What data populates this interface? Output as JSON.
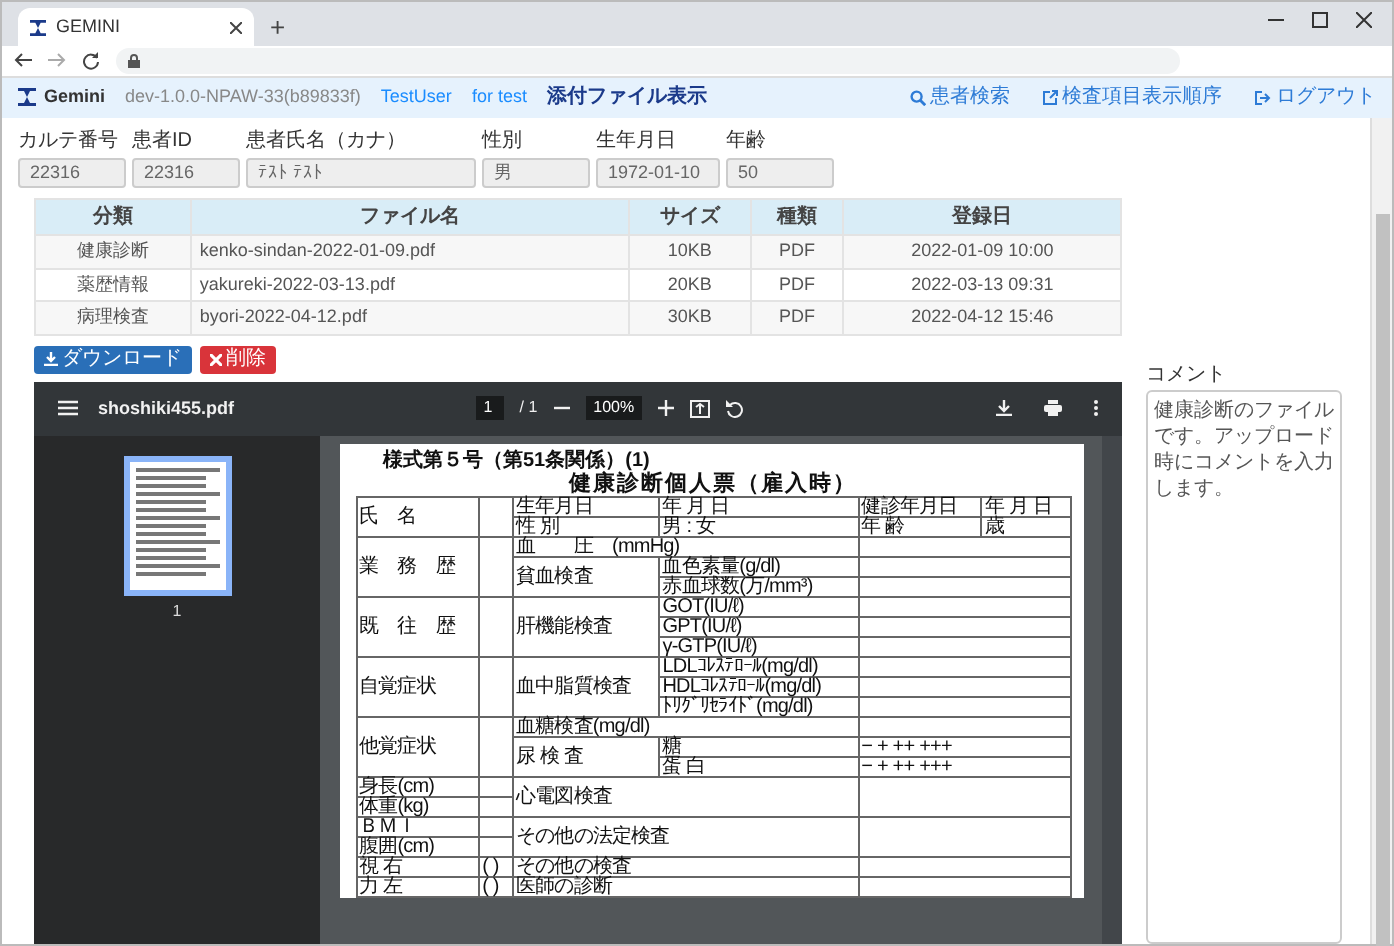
{
  "browser": {
    "tab_title": "GEMINI",
    "new_tab": "+"
  },
  "navbar": {
    "brand": "Gemini",
    "version": "dev-1.0.0-NPAW-33(b89833f)",
    "links": [
      {
        "label": "TestUser",
        "selected": false
      },
      {
        "label": "for test",
        "selected": false
      },
      {
        "label": "添付ファイル表示",
        "selected": true
      }
    ],
    "right_links": [
      {
        "label": "患者検索",
        "kind": "search"
      },
      {
        "label": "検査項目表示順序",
        "kind": "external"
      },
      {
        "label": "ログアウト",
        "kind": "logout"
      }
    ]
  },
  "patient_fields": [
    {
      "label": "カルテ番号",
      "value": "22316"
    },
    {
      "label": "患者ID",
      "value": "22316"
    },
    {
      "label": "患者氏名（カナ）",
      "value": "ﾃｽﾄ ﾃｽﾄ"
    },
    {
      "label": "性別",
      "value": "男"
    },
    {
      "label": "生年月日",
      "value": "1972-01-10"
    },
    {
      "label": "年齢",
      "value": "50"
    }
  ],
  "files_table": {
    "columns": [
      "分類",
      "ファイル名",
      "サイズ",
      "種類",
      "登録日"
    ],
    "rows": [
      [
        "健康診断",
        "kenko-sindan-2022-01-09.pdf",
        "10KB",
        "PDF",
        "2022-01-09 10:00"
      ],
      [
        "薬歴情報",
        "yakureki-2022-03-13.pdf",
        "20KB",
        "PDF",
        "2022-03-13 09:31"
      ],
      [
        "病理検査",
        "byori-2022-04-12.pdf",
        "30KB",
        "PDF",
        "2022-04-12 15:46"
      ]
    ]
  },
  "buttons": [
    {
      "label": "ダウンロード",
      "kind": "download"
    },
    {
      "label": "削除",
      "kind": "delete"
    }
  ],
  "pdf_viewer": {
    "file_name": "shoshiki455.pdf",
    "page": "1",
    "page_total": "/ 1",
    "zoom": "100%",
    "thumbnail_label": "1",
    "document": {
      "form_number": "様式第５号（第51条関係）(1)",
      "title": "健康診断個人票（雇入時）",
      "rows": [
        [
          {
            "text": "氏　名",
            "rowspan": 2
          },
          {
            "rowspan": 2
          },
          {
            "text": "生年月日"
          },
          {
            "text": "年 月 日"
          },
          {
            "text": "健診年月日"
          },
          {
            "text": "年 月 日"
          }
        ],
        [
          {
            "text": "性 別"
          },
          {
            "text": "男 : 女"
          },
          {
            "text": "年 齢"
          },
          {
            "text": "歳"
          }
        ],
        [
          {
            "text": "業　務　歴",
            "rowspan": 3
          },
          {
            "rowspan": 3
          },
          {
            "text": "血　　圧　(mmHg)",
            "colspan": 2
          },
          {
            "colspan": 2
          }
        ],
        [
          {
            "text": "貧血検査",
            "rowspan": 2
          },
          {
            "text": "血色素量(g/dl)"
          },
          {
            "colspan": 2
          }
        ],
        [
          {
            "text": "赤血球数(万/mm³)"
          },
          {
            "colspan": 2
          }
        ],
        [
          {
            "text": "既　往　歴",
            "rowspan": 3
          },
          {
            "rowspan": 3
          },
          {
            "text": "肝機能検査",
            "rowspan": 3
          },
          {
            "text": "GOT(IU/ℓ)"
          },
          {
            "colspan": 2
          }
        ],
        [
          {
            "text": "GPT(IU/ℓ)"
          },
          {
            "colspan": 2
          }
        ],
        [
          {
            "text": "γ-GTP(IU/ℓ)"
          },
          {
            "colspan": 2
          }
        ],
        [
          {
            "text": "自覚症状",
            "rowspan": 3
          },
          {
            "rowspan": 3
          },
          {
            "text": "血中脂質検査",
            "rowspan": 3
          },
          {
            "text": "LDLｺﾚｽﾃﾛｰﾙ(mg/dl)"
          },
          {
            "colspan": 2
          }
        ],
        [
          {
            "text": "HDLｺﾚｽﾃﾛｰﾙ(mg/dl)"
          },
          {
            "colspan": 2
          }
        ],
        [
          {
            "text": "ﾄﾘｸﾞﾘｾﾗｲﾄﾞ(mg/dl)"
          },
          {
            "colspan": 2
          }
        ],
        [
          {
            "text": "他覚症状",
            "rowspan": 3
          },
          {
            "rowspan": 3
          },
          {
            "text": "血糖検査(mg/dl)",
            "colspan": 2
          },
          {
            "colspan": 2
          }
        ],
        [
          {
            "text": "尿 検 査",
            "rowspan": 2
          },
          {
            "text": "糖"
          },
          {
            "text": "− + ++ +++",
            "colspan": 2
          }
        ],
        [
          {
            "text": "蛋 白"
          },
          {
            "text": "− + ++ +++",
            "colspan": 2
          }
        ],
        [
          {
            "text": "身長(cm)"
          },
          {},
          {
            "text": "心電図検査",
            "rowspan": 2,
            "colspan": 2
          },
          {
            "rowspan": 2,
            "colspan": 2
          }
        ],
        [
          {
            "text": "体重(kg)"
          },
          {}
        ],
        [
          {
            "text": "ＢＭＩ"
          },
          {},
          {
            "text": "その他の法定検査",
            "rowspan": 2,
            "colspan": 2
          },
          {
            "rowspan": 2,
            "colspan": 2
          }
        ],
        [
          {
            "text": "腹囲(cm)"
          },
          {}
        ],
        [
          {
            "text": "視 右"
          },
          {
            "text": "(   )"
          },
          {
            "text": "その他の検査",
            "colspan": 2
          },
          {
            "colspan": 2
          }
        ],
        [
          {
            "text": "力 左"
          },
          {
            "text": "(   )"
          },
          {
            "text": "医師の診断",
            "colspan": 2
          },
          {
            "colspan": 2
          }
        ]
      ]
    }
  },
  "comment": {
    "label": "コメント",
    "value": "健康診断のファイルです。アップロード時にコメントを入力します。"
  }
}
